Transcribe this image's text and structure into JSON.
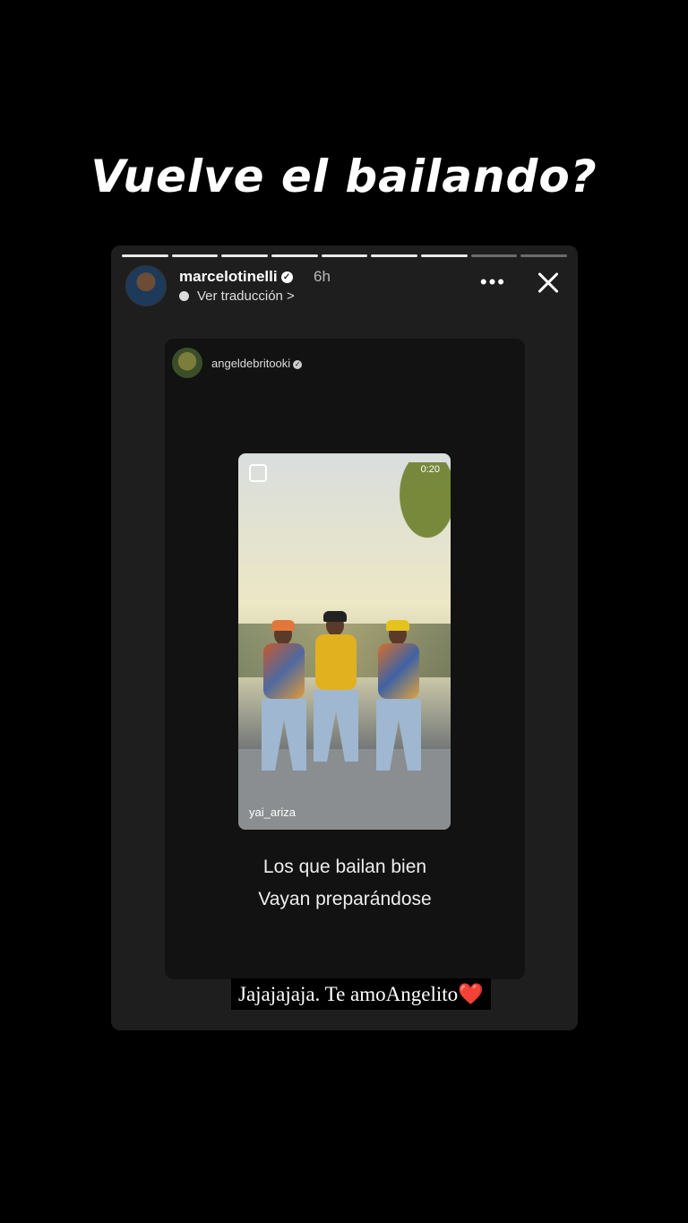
{
  "headline": "Vuelve el bailando?",
  "story": {
    "username": "marcelotinelli",
    "time": "6h",
    "translate_label": "Ver traducción >",
    "more_label": "•••",
    "progress": {
      "segments": 9,
      "current": 5
    }
  },
  "shared_post": {
    "username": "angeldebritooki",
    "video": {
      "duration": "0:20",
      "credit": "yai_ariza"
    },
    "caption_line1": "Los que bailan bien",
    "caption_line2": "Vayan preparándose"
  },
  "overlay_text": "Jajajajaja. Te amoAngelito",
  "overlay_emoji": "❤️",
  "colors": {
    "background": "#000000",
    "card": "#1e1e1e",
    "heart": "#e8102b"
  }
}
